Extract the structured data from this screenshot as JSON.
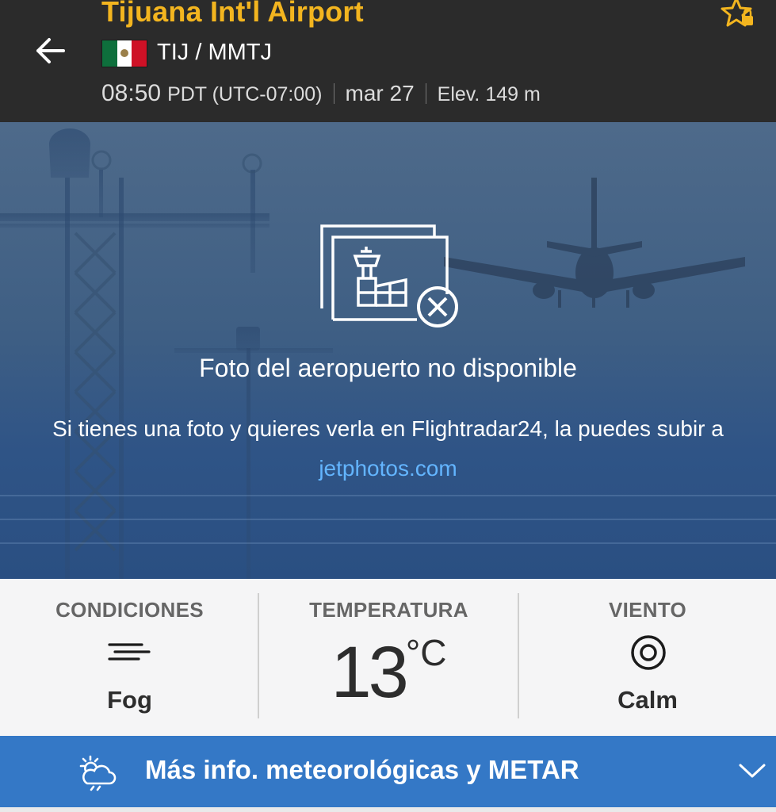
{
  "header": {
    "airport_name": "Tijuana Int'l Airport",
    "codes": "TIJ / MMTJ",
    "flag": "mexico-flag",
    "local_time": "08:50",
    "timezone": "PDT (UTC-07:00)",
    "date": "mar 27",
    "elevation": "Elev. 149 m",
    "back_icon": "back-arrow-icon",
    "favorite_icon": "star-lock-icon"
  },
  "photo": {
    "title": "Foto del aeropuerto no disponible",
    "message": "Si tienes una foto y quieres verla en Flightradar24, la puedes subir a",
    "link_text": "jetphotos.com",
    "icon": "photo-unavailable-icon"
  },
  "weather": {
    "conditions_label": "CONDICIONES",
    "conditions_value": "Fog",
    "conditions_icon": "fog-icon",
    "temperature_label": "TEMPERATURA",
    "temperature_value": "13",
    "temperature_unit": "°C",
    "wind_label": "VIENTO",
    "wind_value": "Calm",
    "wind_icon": "calm-wind-icon"
  },
  "more_info": {
    "label": "Más info. meteorológicas y METAR",
    "icon": "weather-cloud-sun-icon",
    "chevron": "chevron-down-icon"
  },
  "colors": {
    "header_bg": "#2b2b2b",
    "accent": "#f3b51f",
    "link": "#63b5ff",
    "bar_bg": "#3478c6"
  }
}
